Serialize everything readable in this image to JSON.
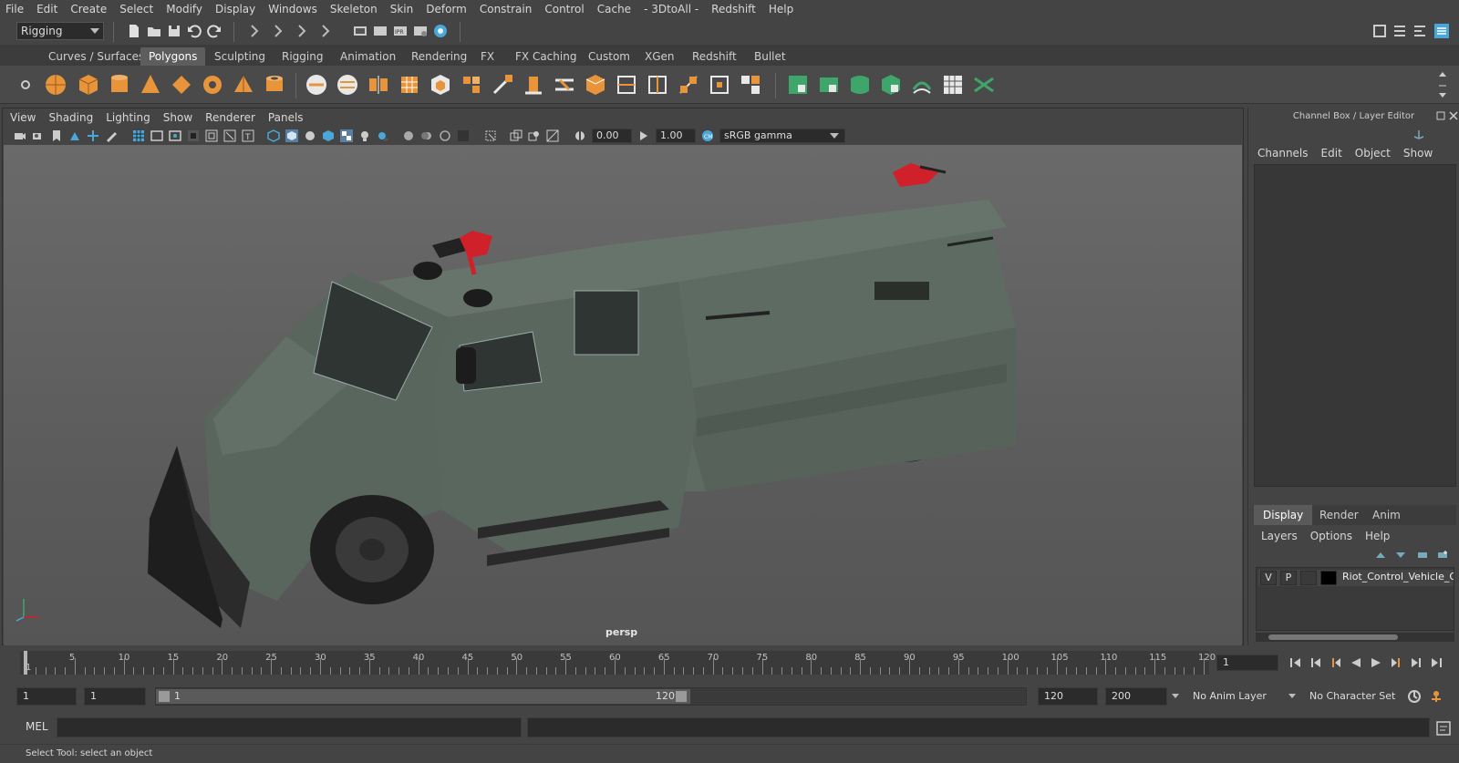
{
  "menu": [
    "File",
    "Edit",
    "Create",
    "Select",
    "Modify",
    "Display",
    "Windows",
    "Skeleton",
    "Skin",
    "Deform",
    "Constrain",
    "Control",
    "Cache",
    "- 3DtoAll -",
    "Redshift",
    "Help"
  ],
  "statusline": {
    "mode": "Rigging"
  },
  "shelf_tabs": [
    "Curves / Surfaces",
    "Polygons",
    "Sculpting",
    "Rigging",
    "Animation",
    "Rendering",
    "FX",
    "FX Caching",
    "Custom",
    "XGen",
    "Redshift",
    "Bullet"
  ],
  "shelf_active": "Polygons",
  "panel_menu": [
    "View",
    "Shading",
    "Lighting",
    "Show",
    "Renderer",
    "Panels"
  ],
  "panel_toolbar": {
    "exposure": "0.00",
    "gamma": "1.00",
    "color_space": "sRGB gamma"
  },
  "viewport": {
    "camera": "persp"
  },
  "right_panel": {
    "title": "Channel Box / Layer Editor",
    "channel_menu": [
      "Channels",
      "Edit",
      "Object",
      "Show"
    ],
    "layer_tabs": [
      "Display",
      "Render",
      "Anim"
    ],
    "layer_tab_active": "Display",
    "layer_menu": [
      "Layers",
      "Options",
      "Help"
    ],
    "layer": {
      "visible": "V",
      "playback": "P",
      "name": "Riot_Control_Vehicle_Gr"
    }
  },
  "timeline": {
    "ticks": [
      "5",
      "10",
      "15",
      "20",
      "25",
      "30",
      "35",
      "40",
      "45",
      "50",
      "55",
      "60",
      "65",
      "70",
      "75",
      "80",
      "85",
      "90",
      "95",
      "100",
      "105",
      "110",
      "115",
      "120"
    ],
    "start_label": "1",
    "current_frame": "1"
  },
  "range": {
    "start": "1",
    "anim_start": "1",
    "slider_start": "1",
    "slider_end": "120",
    "end": "120",
    "anim_end": "200",
    "anim_layer": "No Anim Layer",
    "character_set": "No Character Set"
  },
  "cmdline": {
    "label": "MEL"
  },
  "helpline": {
    "text": "Select Tool: select an object"
  },
  "colors": {
    "vehicle_body": "#5e6b63",
    "accent_red": "#d0202a",
    "shelf_orange": "#e8943a",
    "shelf_green": "#3fa66b"
  }
}
